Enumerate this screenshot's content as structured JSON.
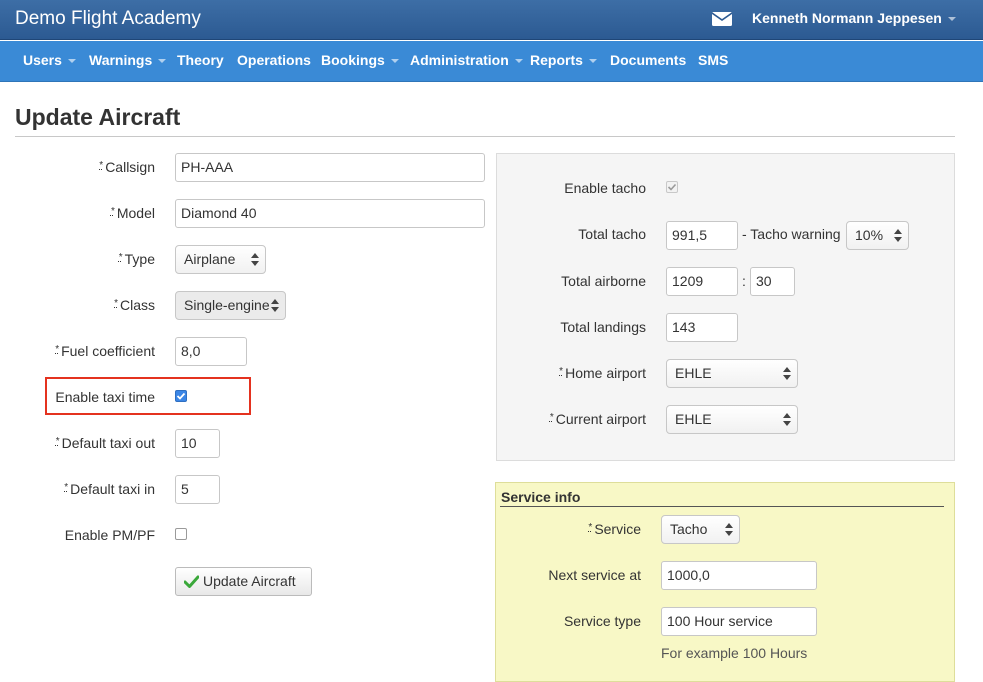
{
  "header": {
    "brand": "Demo Flight Academy",
    "user": "Kenneth Normann Jeppesen"
  },
  "nav": {
    "items": [
      "Users",
      "Warnings",
      "Theory",
      "Operations",
      "Bookings",
      "Administration",
      "Reports",
      "Documents",
      "SMS"
    ]
  },
  "page": {
    "title": "Update Aircraft"
  },
  "form": {
    "required_mark": "*",
    "callsign_label": "Callsign",
    "callsign_value": "PH-AAA",
    "model_label": "Model",
    "model_value": "Diamond 40",
    "type_label": "Type",
    "type_value": "Airplane",
    "class_label": "Class",
    "class_value": "Single-engine",
    "fuel_label": "Fuel coefficient",
    "fuel_value": "8,0",
    "taxi_time_label": "Enable taxi time",
    "taxi_out_label": "Default taxi out",
    "taxi_out_value": "10",
    "taxi_in_label": "Default taxi in",
    "taxi_in_value": "5",
    "pmpf_label": "Enable PM/PF",
    "submit_label": "Update Aircraft"
  },
  "tacho": {
    "enable_label": "Enable tacho",
    "total_label": "Total tacho",
    "total_value": "991,5",
    "warning_label": "- Tacho warning",
    "warning_value": "10%",
    "airborne_label": "Total airborne",
    "airborne_hours": "1209",
    "airborne_sep": ":",
    "airborne_minutes": "30",
    "landings_label": "Total landings",
    "landings_value": "143",
    "home_label": "Home airport",
    "home_value": "EHLE",
    "current_label": "Current airport",
    "current_value": "EHLE"
  },
  "service": {
    "title": "Service info",
    "service_label": "Service",
    "service_value": "Tacho",
    "next_label": "Next service at",
    "next_value": "1000,0",
    "type_label": "Service type",
    "type_value": "100 Hour service",
    "hint": "For example 100 Hours"
  },
  "colors": {
    "topbar": "#2c5a92",
    "navbar": "#3a8ad6",
    "highlight": "#e4321f",
    "checkbox_checked": "#3b86e6",
    "service_panel": "#f8f8c6",
    "check_icon": "#3aa83a"
  },
  "icons": {
    "mail": "envelope-icon",
    "submit": "check-icon",
    "select": "select-arrows-icon"
  }
}
